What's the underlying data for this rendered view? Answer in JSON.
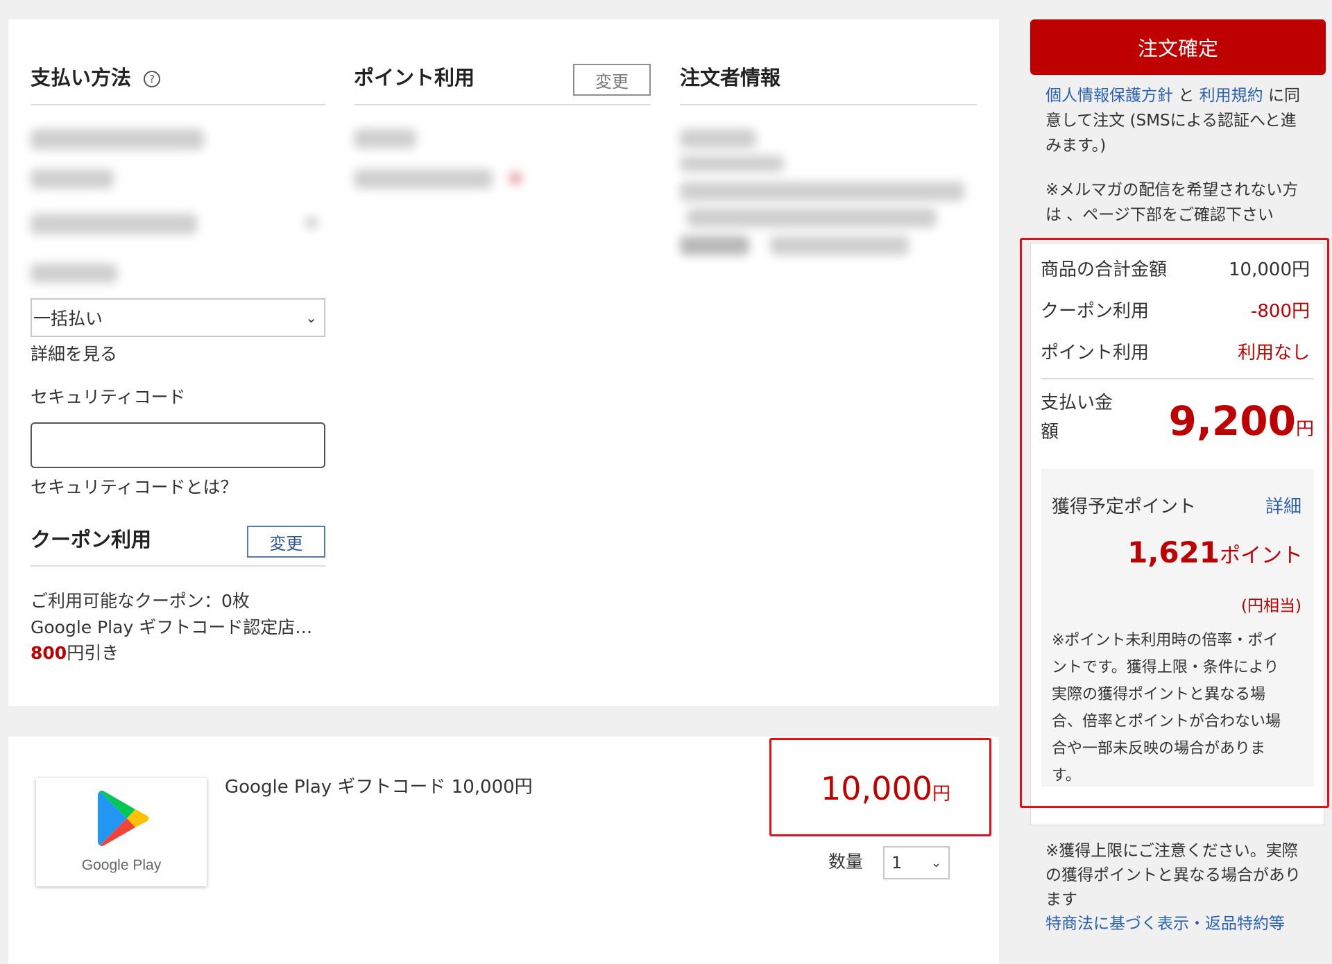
{
  "payment": {
    "heading": "支払い方法",
    "help_icon": "question-circle-icon",
    "installment_selected": "一括払い",
    "details_link": "詳細を見る",
    "security_code_label": "セキュリティコード",
    "security_code_value": "",
    "security_code_help": "セキュリティコードとは？"
  },
  "points": {
    "heading": "ポイント利用",
    "change_label": "変更"
  },
  "orderer": {
    "heading": "注文者情報"
  },
  "coupon": {
    "heading": "クーポン利用",
    "change_label": "変更",
    "available": "ご利用可能なクーポン：0枚",
    "shop": "Google Play ギフトコード認定店…",
    "discount_amount": "800",
    "discount_suffix": "円引き"
  },
  "product": {
    "image_label": "Google Play",
    "name": "Google Play ギフトコード 10,000円",
    "price": "10,000",
    "price_unit": "円",
    "quantity_label": "数量",
    "quantity": "1"
  },
  "summary": {
    "confirm_button": "注文確定",
    "privacy_link": "個人情報保護方針",
    "and": "と",
    "terms_link": "利用規約",
    "agree_text_1": "に同",
    "agree_text_2": "意して注文 (SMSによる認証へと進",
    "agree_text_3": "みます。)",
    "mail_note_1": "※メルマガの配信を希望されない方",
    "mail_note_2": "は 、ページ下部をご確認下さい",
    "subtotal_label": "商品の合計金額",
    "subtotal_value": "10,000円",
    "coupon_label": "クーポン利用",
    "coupon_value": "-800円",
    "point_label": "ポイント利用",
    "point_value": "利用なし",
    "pay_label_1": "支払い金",
    "pay_label_2": "額",
    "pay_amount": "9,200",
    "pay_unit": "円",
    "earn_label": "獲得予定ポイント",
    "earn_detail_link": "詳細",
    "earn_amount": "1,621",
    "earn_unit": "ポイント",
    "earn_equiv": "(円相当)",
    "earn_note_1": "※ポイント未利用時の倍率・ポイ",
    "earn_note_2": "ントです。獲得上限・条件により",
    "earn_note_3": "実際の獲得ポイントと異なる場",
    "earn_note_4": "合、倍率とポイントが合わない場",
    "earn_note_5": "合や一部未反映の場合がありま",
    "earn_note_6": "す。",
    "limit_note_1": "※獲得上限にご注意ください。実際",
    "limit_note_2": "の獲得ポイントと異なる場合があり",
    "limit_note_3": "ます",
    "legal_link": "特商法に基づく表示・返品特約等"
  },
  "colors": {
    "brand_red": "#bf0000",
    "link_blue": "#2a61b4",
    "highlight_red": "#e0101a"
  }
}
